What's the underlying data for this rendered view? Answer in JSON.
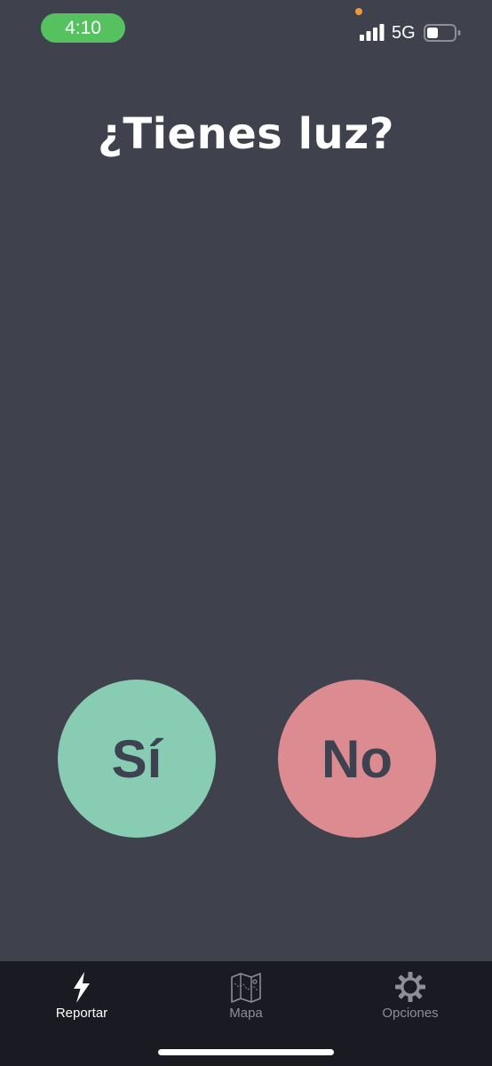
{
  "status_bar": {
    "time": "4:10",
    "network": "5G",
    "time_pill_color": "#56c25f",
    "privacy_dot_color": "#ef9a36",
    "battery_level": 0.4
  },
  "main": {
    "title": "¿Tienes luz?",
    "background_color": "#3f414d"
  },
  "buttons": {
    "yes_label": "Sí",
    "no_label": "No",
    "yes_color": "#87ccb3",
    "no_color": "#dc8c90"
  },
  "tab_bar": {
    "active_tab": "Reportar",
    "tabs": [
      {
        "label": "Reportar",
        "icon": "lightning-bolt-icon",
        "active": true
      },
      {
        "label": "Mapa",
        "icon": "map-icon",
        "active": false
      },
      {
        "label": "Opciones",
        "icon": "gear-icon",
        "active": false
      }
    ]
  }
}
